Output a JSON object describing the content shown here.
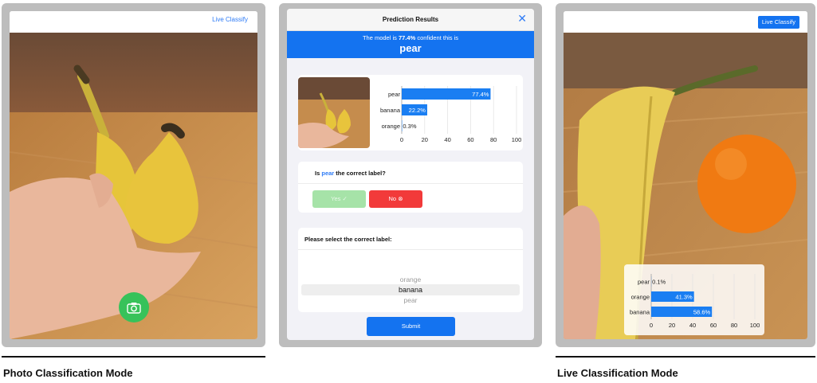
{
  "photo_panel": {
    "live_classify_link": "Live Classify",
    "camera_button_icon": "camera-icon"
  },
  "prediction_modal": {
    "title": "Prediction Results",
    "close_icon": "close-icon",
    "banner_prefix": "The model is",
    "banner_confidence": "77.4%",
    "banner_suffix": "confident this is",
    "predicted_label": "pear",
    "question_prefix": "Is",
    "question_label": "pear",
    "question_suffix": "the correct label?",
    "yes_label": "Yes",
    "no_label": "No",
    "select_title": "Please select the correct label:",
    "picker_options": [
      "orange",
      "banana",
      "pear"
    ],
    "picker_selected": "banana",
    "submit_label": "Submit"
  },
  "live_panel": {
    "live_classify_button": "Live Classify"
  },
  "captions": {
    "photo_mode": "Photo Classification Mode",
    "live_mode": "Live Classification Mode"
  },
  "colors": {
    "accent_blue": "#1473f0",
    "bar_blue": "#1a7ef2",
    "yes_green": "#a6e3a8",
    "no_red": "#f23a3a",
    "camera_green": "#37c25a"
  },
  "chart_data": [
    {
      "type": "bar",
      "orientation": "horizontal",
      "categories": [
        "pear",
        "banana",
        "orange"
      ],
      "values": [
        77.4,
        22.2,
        0.3
      ],
      "data_labels": [
        "77.4%",
        "22.2%",
        "0.3%"
      ],
      "xlim": [
        0,
        100
      ],
      "x_ticks": [
        0,
        20,
        40,
        60,
        80,
        100
      ],
      "grid": true
    },
    {
      "type": "bar",
      "orientation": "horizontal",
      "categories": [
        "pear",
        "orange",
        "banana"
      ],
      "values": [
        0.1,
        41.3,
        58.6
      ],
      "data_labels": [
        "0.1%",
        "41.3%",
        "58.6%"
      ],
      "xlim": [
        0,
        100
      ],
      "x_ticks": [
        0,
        20,
        40,
        60,
        80,
        100
      ],
      "grid": true
    }
  ]
}
